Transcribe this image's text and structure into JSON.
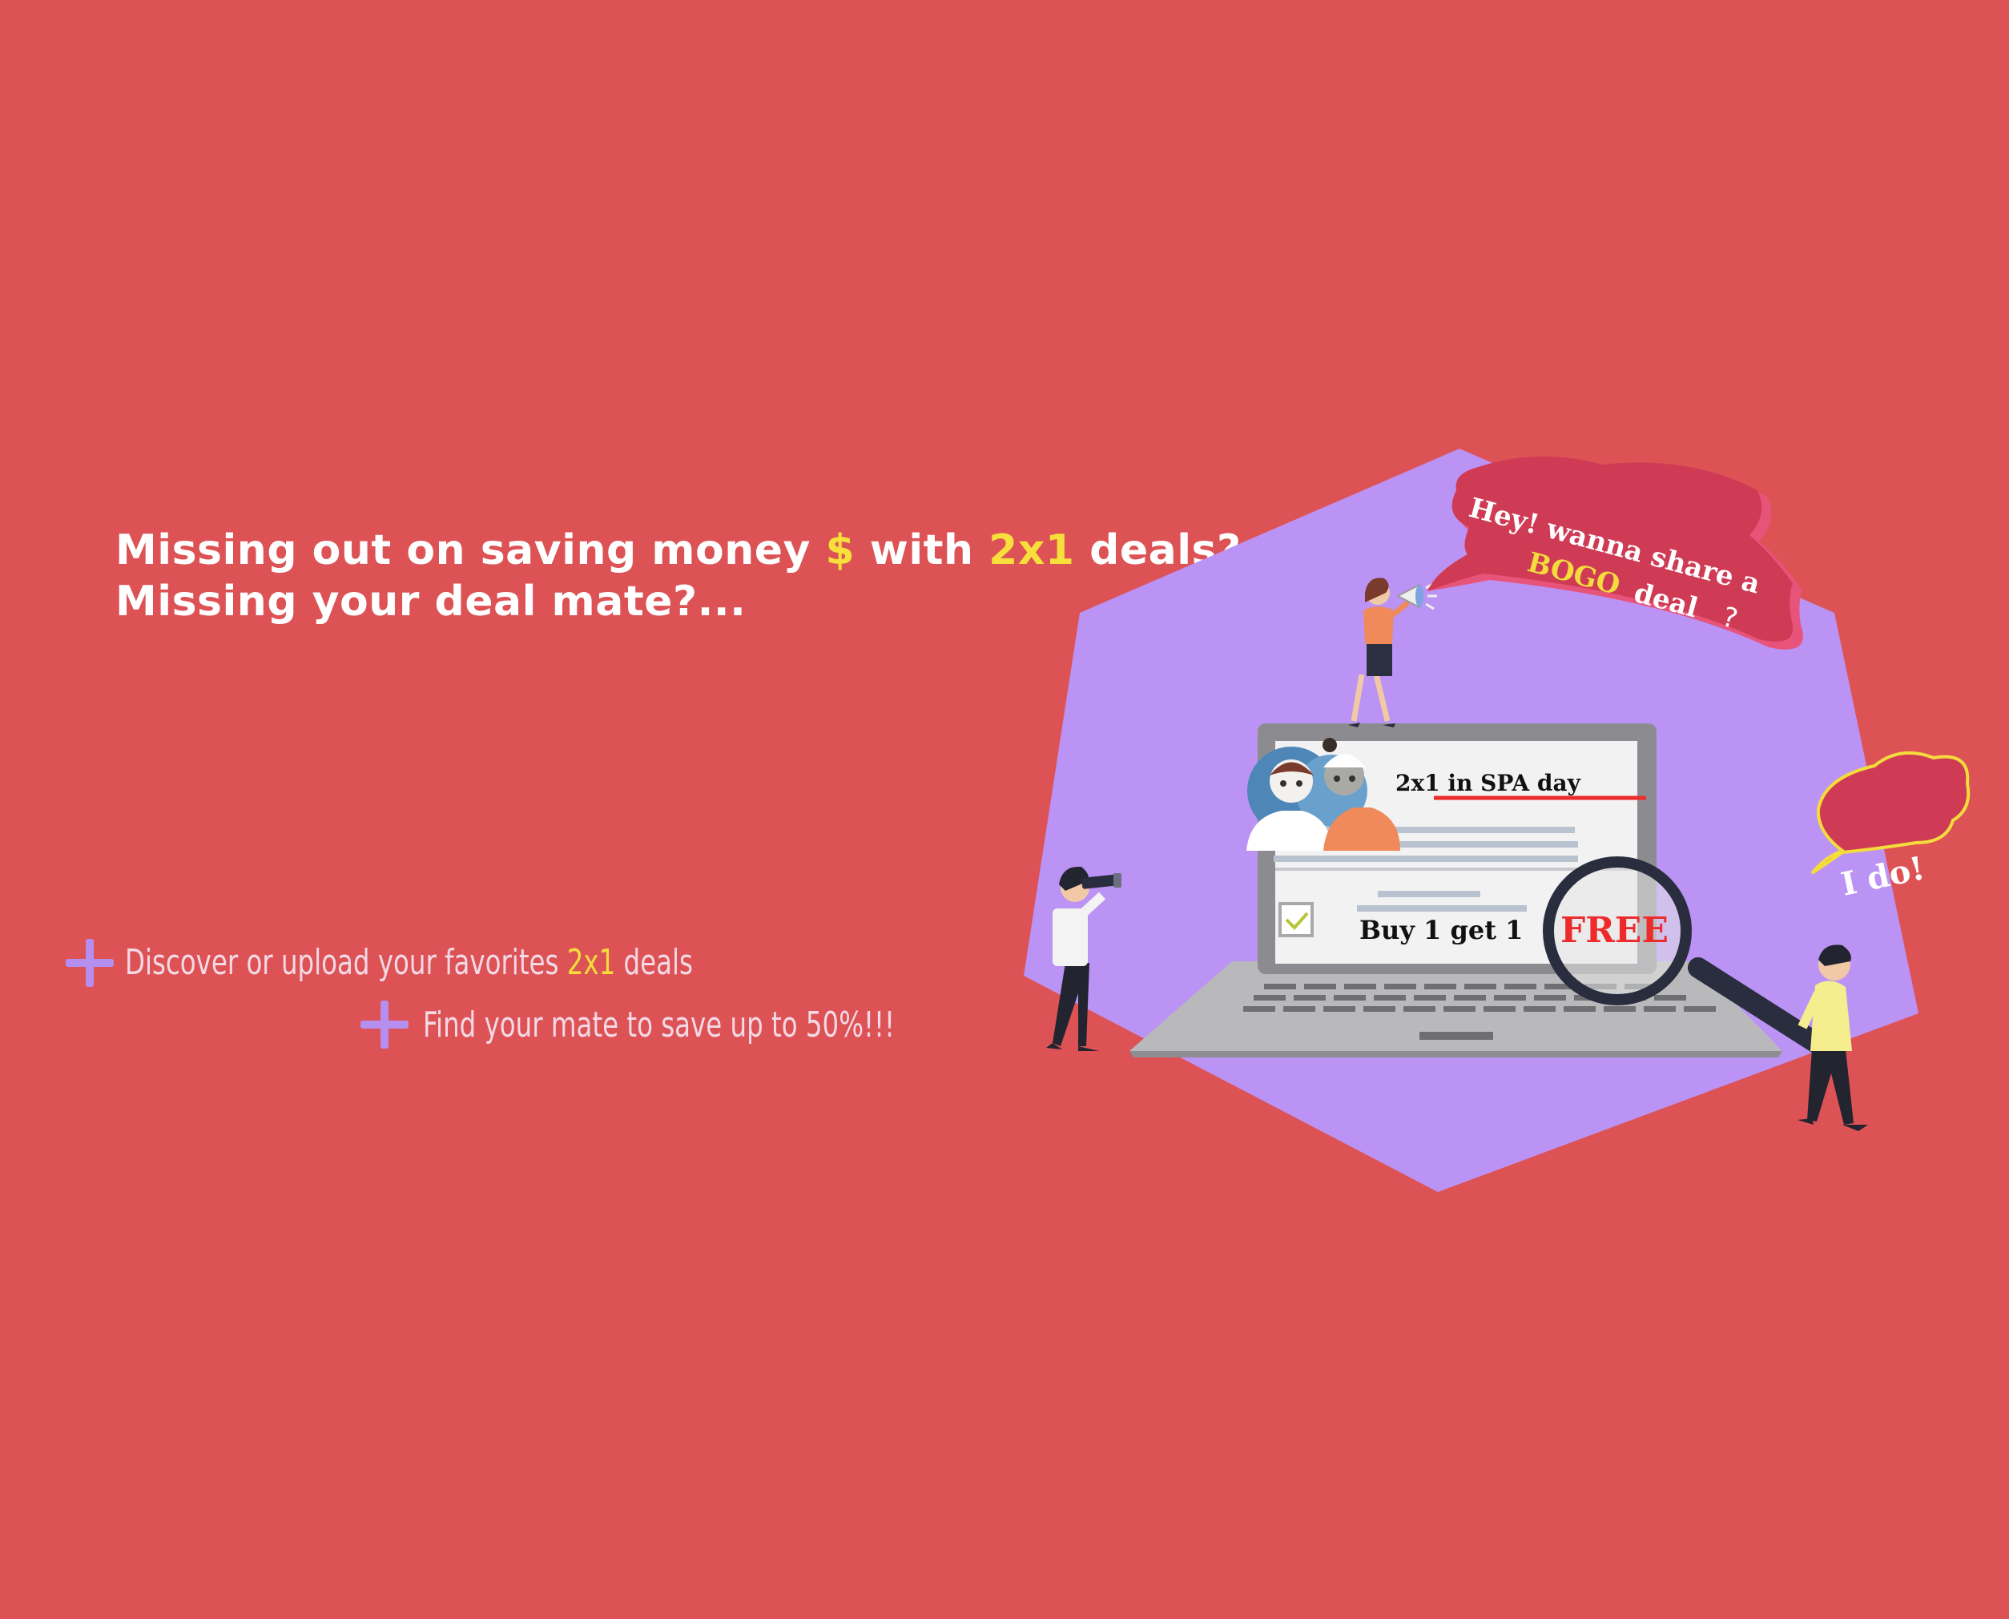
{
  "headline": {
    "line1_part1": "Missing out on saving money ",
    "line1_dollar": "$",
    "line1_part2": " with ",
    "line1_highlight": "2x1",
    "line1_part3": " deals?",
    "line2": "Missing your deal mate?..."
  },
  "features": [
    {
      "text_before": "Discover or upload your favorites ",
      "highlight": "2x1",
      "text_after": " deals"
    },
    {
      "text_before": "Find your mate to save up to 50%!!!"
    }
  ],
  "illustration": {
    "speech_bubble": {
      "line1": "Hey! wanna share a",
      "highlight": "BOGO",
      "line2_rest": " deal",
      "question": "?"
    },
    "reply_bubble": "I do!",
    "deal_card": {
      "title": "2x1 in SPA day",
      "offer": "Buy 1 get 1",
      "free": "FREE"
    }
  },
  "colors": {
    "background": "#dd5254",
    "hexagon": "#bb93f4",
    "highlight": "#f7df3c",
    "bubble": "#d03a55",
    "free_text": "#ee2b2b"
  }
}
